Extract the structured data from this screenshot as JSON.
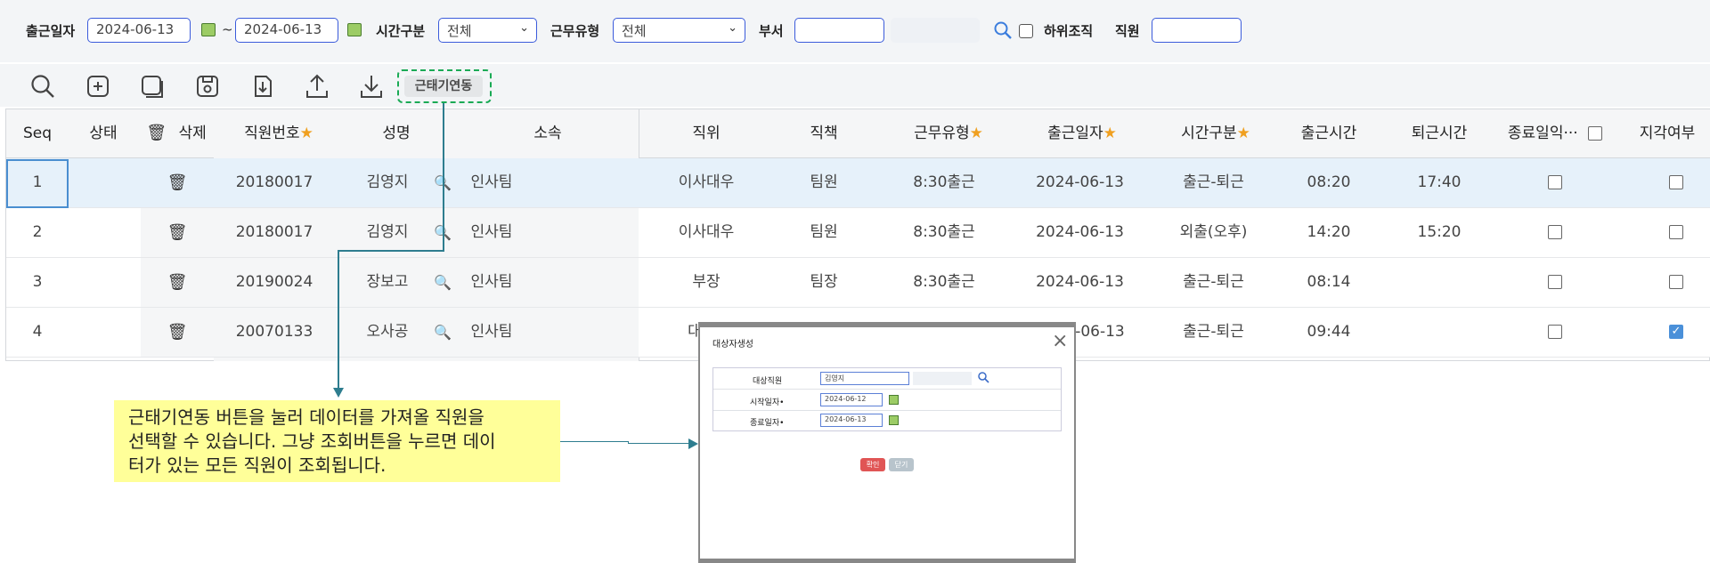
{
  "filters": {
    "date_label": "출근일자",
    "date_from": "2024-06-13",
    "date_sep": "~",
    "date_to": "2024-06-13",
    "time_type_label": "시간구분",
    "time_type_value": "전체",
    "work_type_label": "근무유형",
    "work_type_value": "전체",
    "dept_label": "부서",
    "dept_value": "",
    "sub_org_label": "하위조직",
    "employee_label": "직원",
    "employee_value": ""
  },
  "toolbar": {
    "sync_button_label": "근태기연동"
  },
  "grid": {
    "columns": {
      "seq": "Seq",
      "status": "상태",
      "delete": "삭제",
      "emp_no": "직원번호",
      "name": "성명",
      "dept": "소속",
      "position": "직위",
      "duty": "직책",
      "work_type": "근무유형",
      "date": "출근일자",
      "time_type": "시간구분",
      "in_time": "출근시간",
      "out_time": "퇴근시간",
      "end_next_day": "종료일익···",
      "late": "지각여부"
    },
    "rows": [
      {
        "seq": "1",
        "emp_no": "20180017",
        "name": "김영지",
        "dept": "인사팀",
        "position": "이사대우",
        "duty": "팀원",
        "work_type": "8:30출근",
        "date": "2024-06-13",
        "time_type": "출근-퇴근",
        "in_time": "08:20",
        "out_time": "17:40",
        "end_next_day": false,
        "late": false
      },
      {
        "seq": "2",
        "emp_no": "20180017",
        "name": "김영지",
        "dept": "인사팀",
        "position": "이사대우",
        "duty": "팀원",
        "work_type": "8:30출근",
        "date": "2024-06-13",
        "time_type": "외출(오후)",
        "in_time": "14:20",
        "out_time": "15:20",
        "end_next_day": false,
        "late": false
      },
      {
        "seq": "3",
        "emp_no": "20190024",
        "name": "장보고",
        "dept": "인사팀",
        "position": "부장",
        "duty": "팀장",
        "work_type": "8:30출근",
        "date": "2024-06-13",
        "time_type": "출근-퇴근",
        "in_time": "08:14",
        "out_time": "",
        "end_next_day": false,
        "late": false
      },
      {
        "seq": "4",
        "emp_no": "20070133",
        "name": "오사공",
        "dept": "인사팀",
        "position": "대",
        "date": "-06-13",
        "time_type": "출근-퇴근",
        "in_time": "09:44",
        "out_time": "",
        "end_next_day": false,
        "late": true
      }
    ]
  },
  "callout": {
    "line1": "근태기연동 버튼을 눌러 데이터를 가져올 직원을",
    "line2": "선택할 수 있습니다. 그냥 조회버튼을 누르면 데이",
    "line3": "터가 있는 모든 직원이 조회됩니다."
  },
  "dialog": {
    "title": "대상자생성",
    "target_label": "대상직원",
    "target_value": "김영지",
    "start_label": "시작일자•",
    "start_value": "2024-06-12",
    "end_label": "종료일자•",
    "end_value": "2024-06-13",
    "confirm_label": "확인",
    "close_label": "닫기"
  },
  "colors": {
    "accent_border": "#3b5bdb",
    "selected_row": "#e6f1fa",
    "dashed_highlight": "#1aaa55",
    "callout_bg": "#ffff99",
    "confirm_button": "#e05555",
    "star": "#f0a020"
  }
}
